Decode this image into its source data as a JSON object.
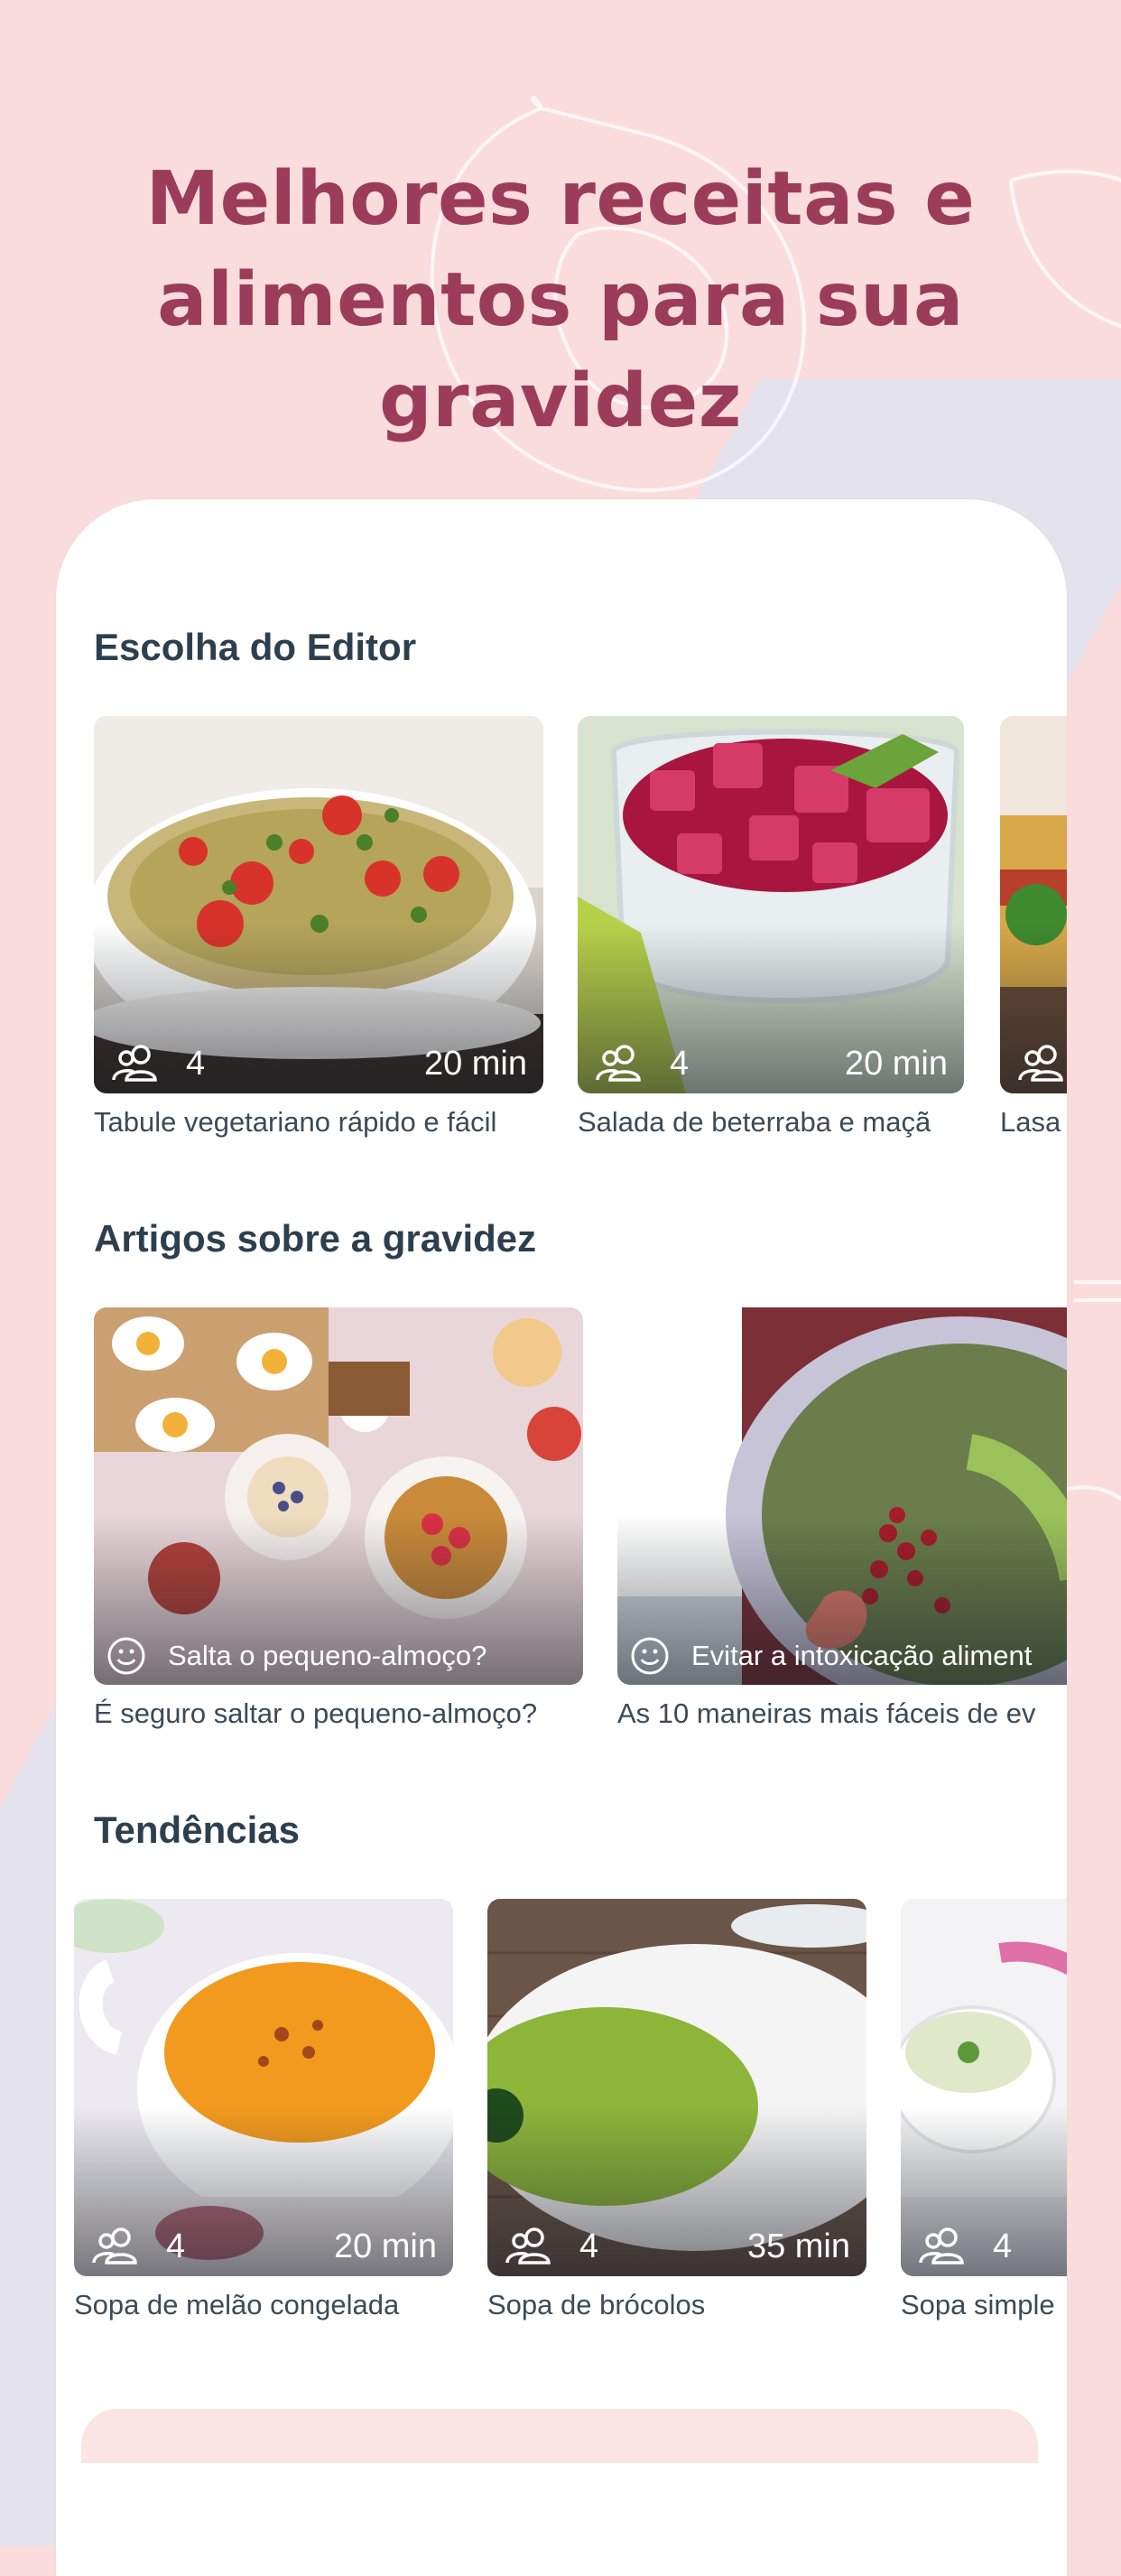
{
  "hero": {
    "line1": "Melhores receitas e",
    "line2": "alimentos para sua gravidez"
  },
  "sections": {
    "editor": {
      "title": "Escolha do Editor",
      "cards": [
        {
          "servings": "4",
          "time": "20 min",
          "caption": "Tabule vegetariano rápido e fácil"
        },
        {
          "servings": "4",
          "time": "20 min",
          "caption": "Salada de beterraba e maçã"
        },
        {
          "servings": "4",
          "time": "",
          "caption": "Lasa"
        }
      ]
    },
    "articles": {
      "title": "Artigos sobre a gravidez",
      "cards": [
        {
          "tag": "Salta o pequeno-almoço?",
          "caption": "É seguro saltar o pequeno-almoço?"
        },
        {
          "tag": "Evitar a intoxicação aliment",
          "caption": "As 10 maneiras mais fáceis de ev"
        }
      ]
    },
    "trends": {
      "title": "Tendências",
      "cards": [
        {
          "servings": "4",
          "time": "20 min",
          "caption": "Sopa de melão congelada"
        },
        {
          "servings": "4",
          "time": "35 min",
          "caption": "Sopa de brócolos"
        },
        {
          "servings": "4",
          "time": "",
          "caption": "Sopa simple"
        }
      ]
    }
  },
  "icons": {
    "servings": "people-icon",
    "article": "smiley-icon"
  },
  "colors": {
    "background": "#fbdcdc",
    "title": "#9b3c5a",
    "section_title": "#2d3f4f",
    "caption": "#3c4a58"
  }
}
